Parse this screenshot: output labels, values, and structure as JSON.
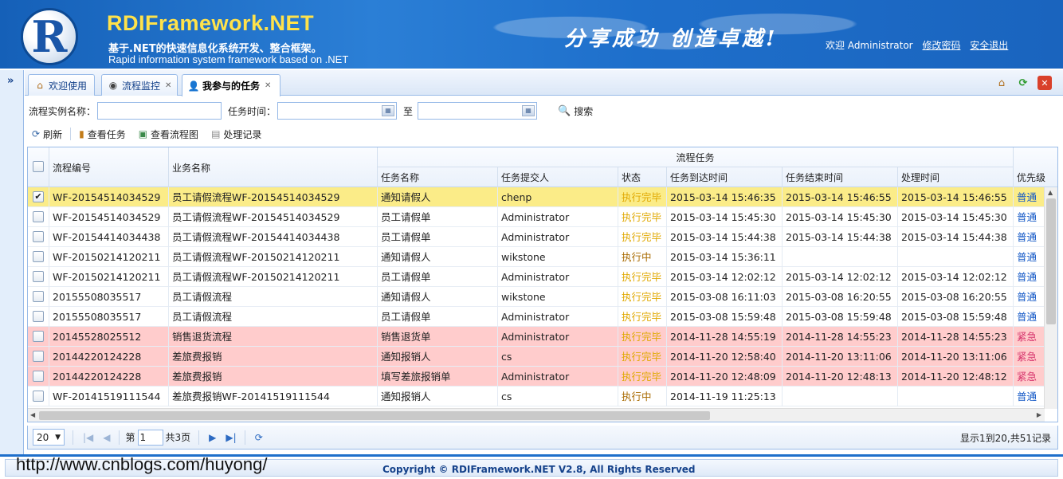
{
  "header": {
    "logo_letter": "R",
    "title": "RDIFramework.NET",
    "subtitle_cn": "基于.NET的快速信息化系统开发、整合框架。",
    "subtitle_en": "Rapid information system framework based on .NET",
    "slogan": "分享成功  创造卓越!",
    "welcome": "欢迎 Administrator",
    "change_password": "修改密码",
    "logout": "安全退出"
  },
  "sidebar": {
    "expand_glyph": "»"
  },
  "tabs": [
    {
      "label": "欢迎使用",
      "icon": "home-icon",
      "closable": false
    },
    {
      "label": "流程监控",
      "icon": "eye-icon",
      "closable": true
    },
    {
      "label": "我参与的任务",
      "icon": "user-task-icon",
      "closable": true,
      "active": true
    }
  ],
  "tab_tools": {
    "home": "home-icon",
    "refresh": "refresh-icon",
    "close": "close-icon"
  },
  "search": {
    "instance_label": "流程实例名称：",
    "instance_value": "",
    "time_label": "任务时间：",
    "time_from": "",
    "to_label": "至",
    "time_to": "",
    "button": "搜索"
  },
  "toolbar": {
    "refresh": "刷新",
    "view_task": "查看任务",
    "view_flowchart": "查看流程图",
    "records": "处理记录"
  },
  "grid": {
    "headers": {
      "flow_no": "流程编号",
      "biz_name": "业务名称",
      "group": "流程任务",
      "task_name": "任务名称",
      "submitter": "任务提交人",
      "status": "状态",
      "arrive_time": "任务到达时间",
      "end_time": "任务结束时间",
      "process_time": "处理时间",
      "priority": "优先级"
    },
    "rows": [
      {
        "checked": true,
        "type": "selected",
        "flow_no": "WF-20154514034529",
        "biz_name": "员工请假流程WF-20154514034529",
        "task_name": "通知请假人",
        "submitter": "chenp",
        "status": "执行完毕",
        "arrive": "2015-03-14 15:46:35",
        "end": "2015-03-14 15:46:55",
        "process": "2015-03-14 15:46:55",
        "priority": "普通"
      },
      {
        "checked": false,
        "type": "normal",
        "flow_no": "WF-20154514034529",
        "biz_name": "员工请假流程WF-20154514034529",
        "task_name": "员工请假单",
        "submitter": "Administrator",
        "status": "执行完毕",
        "arrive": "2015-03-14 15:45:30",
        "end": "2015-03-14 15:45:30",
        "process": "2015-03-14 15:45:30",
        "priority": "普通"
      },
      {
        "checked": false,
        "type": "normal",
        "flow_no": "WF-20154414034438",
        "biz_name": "员工请假流程WF-20154414034438",
        "task_name": "员工请假单",
        "submitter": "Administrator",
        "status": "执行完毕",
        "arrive": "2015-03-14 15:44:38",
        "end": "2015-03-14 15:44:38",
        "process": "2015-03-14 15:44:38",
        "priority": "普通"
      },
      {
        "checked": false,
        "type": "normal",
        "flow_no": "WF-20150214120211",
        "biz_name": "员工请假流程WF-20150214120211",
        "task_name": "通知请假人",
        "submitter": "wikstone",
        "status": "执行中",
        "arrive": "2015-03-14 15:36:11",
        "end": "",
        "process": "",
        "priority": "普通"
      },
      {
        "checked": false,
        "type": "normal",
        "flow_no": "WF-20150214120211",
        "biz_name": "员工请假流程WF-20150214120211",
        "task_name": "员工请假单",
        "submitter": "Administrator",
        "status": "执行完毕",
        "arrive": "2015-03-14 12:02:12",
        "end": "2015-03-14 12:02:12",
        "process": "2015-03-14 12:02:12",
        "priority": "普通"
      },
      {
        "checked": false,
        "type": "normal",
        "flow_no": "20155508035517",
        "biz_name": "员工请假流程",
        "task_name": "通知请假人",
        "submitter": "wikstone",
        "status": "执行完毕",
        "arrive": "2015-03-08 16:11:03",
        "end": "2015-03-08 16:20:55",
        "process": "2015-03-08 16:20:55",
        "priority": "普通"
      },
      {
        "checked": false,
        "type": "normal",
        "flow_no": "20155508035517",
        "biz_name": "员工请假流程",
        "task_name": "员工请假单",
        "submitter": "Administrator",
        "status": "执行完毕",
        "arrive": "2015-03-08 15:59:48",
        "end": "2015-03-08 15:59:48",
        "process": "2015-03-08 15:59:48",
        "priority": "普通"
      },
      {
        "checked": false,
        "type": "urgent",
        "flow_no": "20145528025512",
        "biz_name": "销售退货流程",
        "task_name": "销售退货单",
        "submitter": "Administrator",
        "status": "执行完毕",
        "arrive": "2014-11-28 14:55:19",
        "end": "2014-11-28 14:55:23",
        "process": "2014-11-28 14:55:23",
        "priority": "紧急"
      },
      {
        "checked": false,
        "type": "urgent",
        "flow_no": "20144220124228",
        "biz_name": "差旅费报销",
        "task_name": "通知报销人",
        "submitter": "cs",
        "status": "执行完毕",
        "arrive": "2014-11-20 12:58:40",
        "end": "2014-11-20 13:11:06",
        "process": "2014-11-20 13:11:06",
        "priority": "紧急"
      },
      {
        "checked": false,
        "type": "urgent",
        "flow_no": "20144220124228",
        "biz_name": "差旅费报销",
        "task_name": "填写差旅报销单",
        "submitter": "Administrator",
        "status": "执行完毕",
        "arrive": "2014-11-20 12:48:09",
        "end": "2014-11-20 12:48:13",
        "process": "2014-11-20 12:48:12",
        "priority": "紧急"
      },
      {
        "checked": false,
        "type": "normal",
        "flow_no": "WF-20141519111544",
        "biz_name": "差旅费报销WF-20141519111544",
        "task_name": "通知报销人",
        "submitter": "cs",
        "status": "执行中",
        "arrive": "2014-11-19 11:25:13",
        "end": "",
        "process": "",
        "priority": "普通"
      }
    ]
  },
  "pager": {
    "page_size": "20",
    "page_prefix": "第",
    "page_current": "1",
    "page_total": "共3页",
    "info": "显示1到20,共51记录"
  },
  "footer": {
    "blog_url": "http://www.cnblogs.com/huyong/",
    "copyright": "Copyright © RDIFramework.NET V2.8, All Rights Reserved"
  },
  "colors": {
    "header_blue": "#1e6fcb",
    "title_yellow": "#ffe24a",
    "selected_row": "#fbec88",
    "urgent_row": "#ffcccc",
    "status_done": "#e0a800",
    "priority_normal": "#1459c7",
    "priority_urgent": "#d6336c"
  }
}
